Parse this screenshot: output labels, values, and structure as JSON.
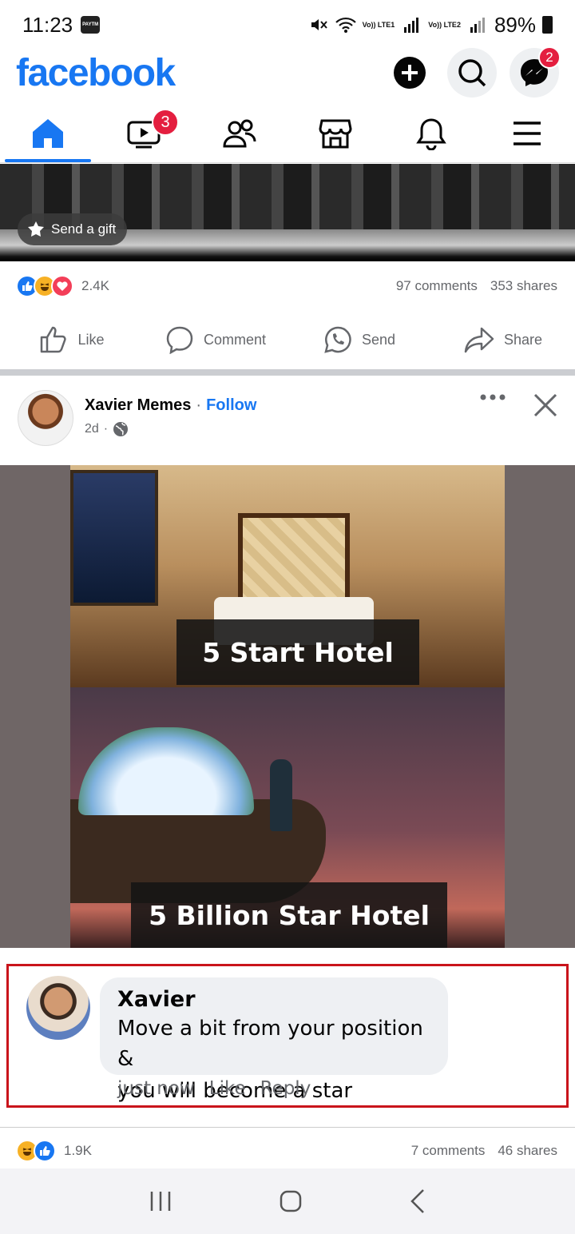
{
  "status_bar": {
    "time": "11:23",
    "paytm_label": "PAYTM",
    "lte1": "Vo)) LTE1",
    "lte2": "Vo)) LTE2",
    "battery": "89%"
  },
  "header": {
    "logo": "facebook",
    "messenger_badge": "2"
  },
  "nav": {
    "video_badge": "3"
  },
  "post1": {
    "gift_label": "Send a gift",
    "reaction_count": "2.4K",
    "comments": "97 comments",
    "shares": "353 shares",
    "actions": [
      "Like",
      "Comment",
      "Send",
      "Share"
    ]
  },
  "post2": {
    "author": "Xavier Memes",
    "follow": "Follow",
    "time": "2d",
    "meme_caption_top": "5 Start Hotel",
    "meme_caption_bottom": "5 Billion Star Hotel",
    "comment": {
      "name": "Xavier",
      "line1": "Move a bit from your position &",
      "line2": "you will become a star",
      "time": "just now",
      "like": "Like",
      "reply": "Reply"
    },
    "reaction_count": "1.9K",
    "comments": "7 comments",
    "shares": "46 shares"
  },
  "colors": {
    "brand": "#1877f2",
    "badge": "#e41e3f",
    "highlight_border": "#c9141b"
  }
}
